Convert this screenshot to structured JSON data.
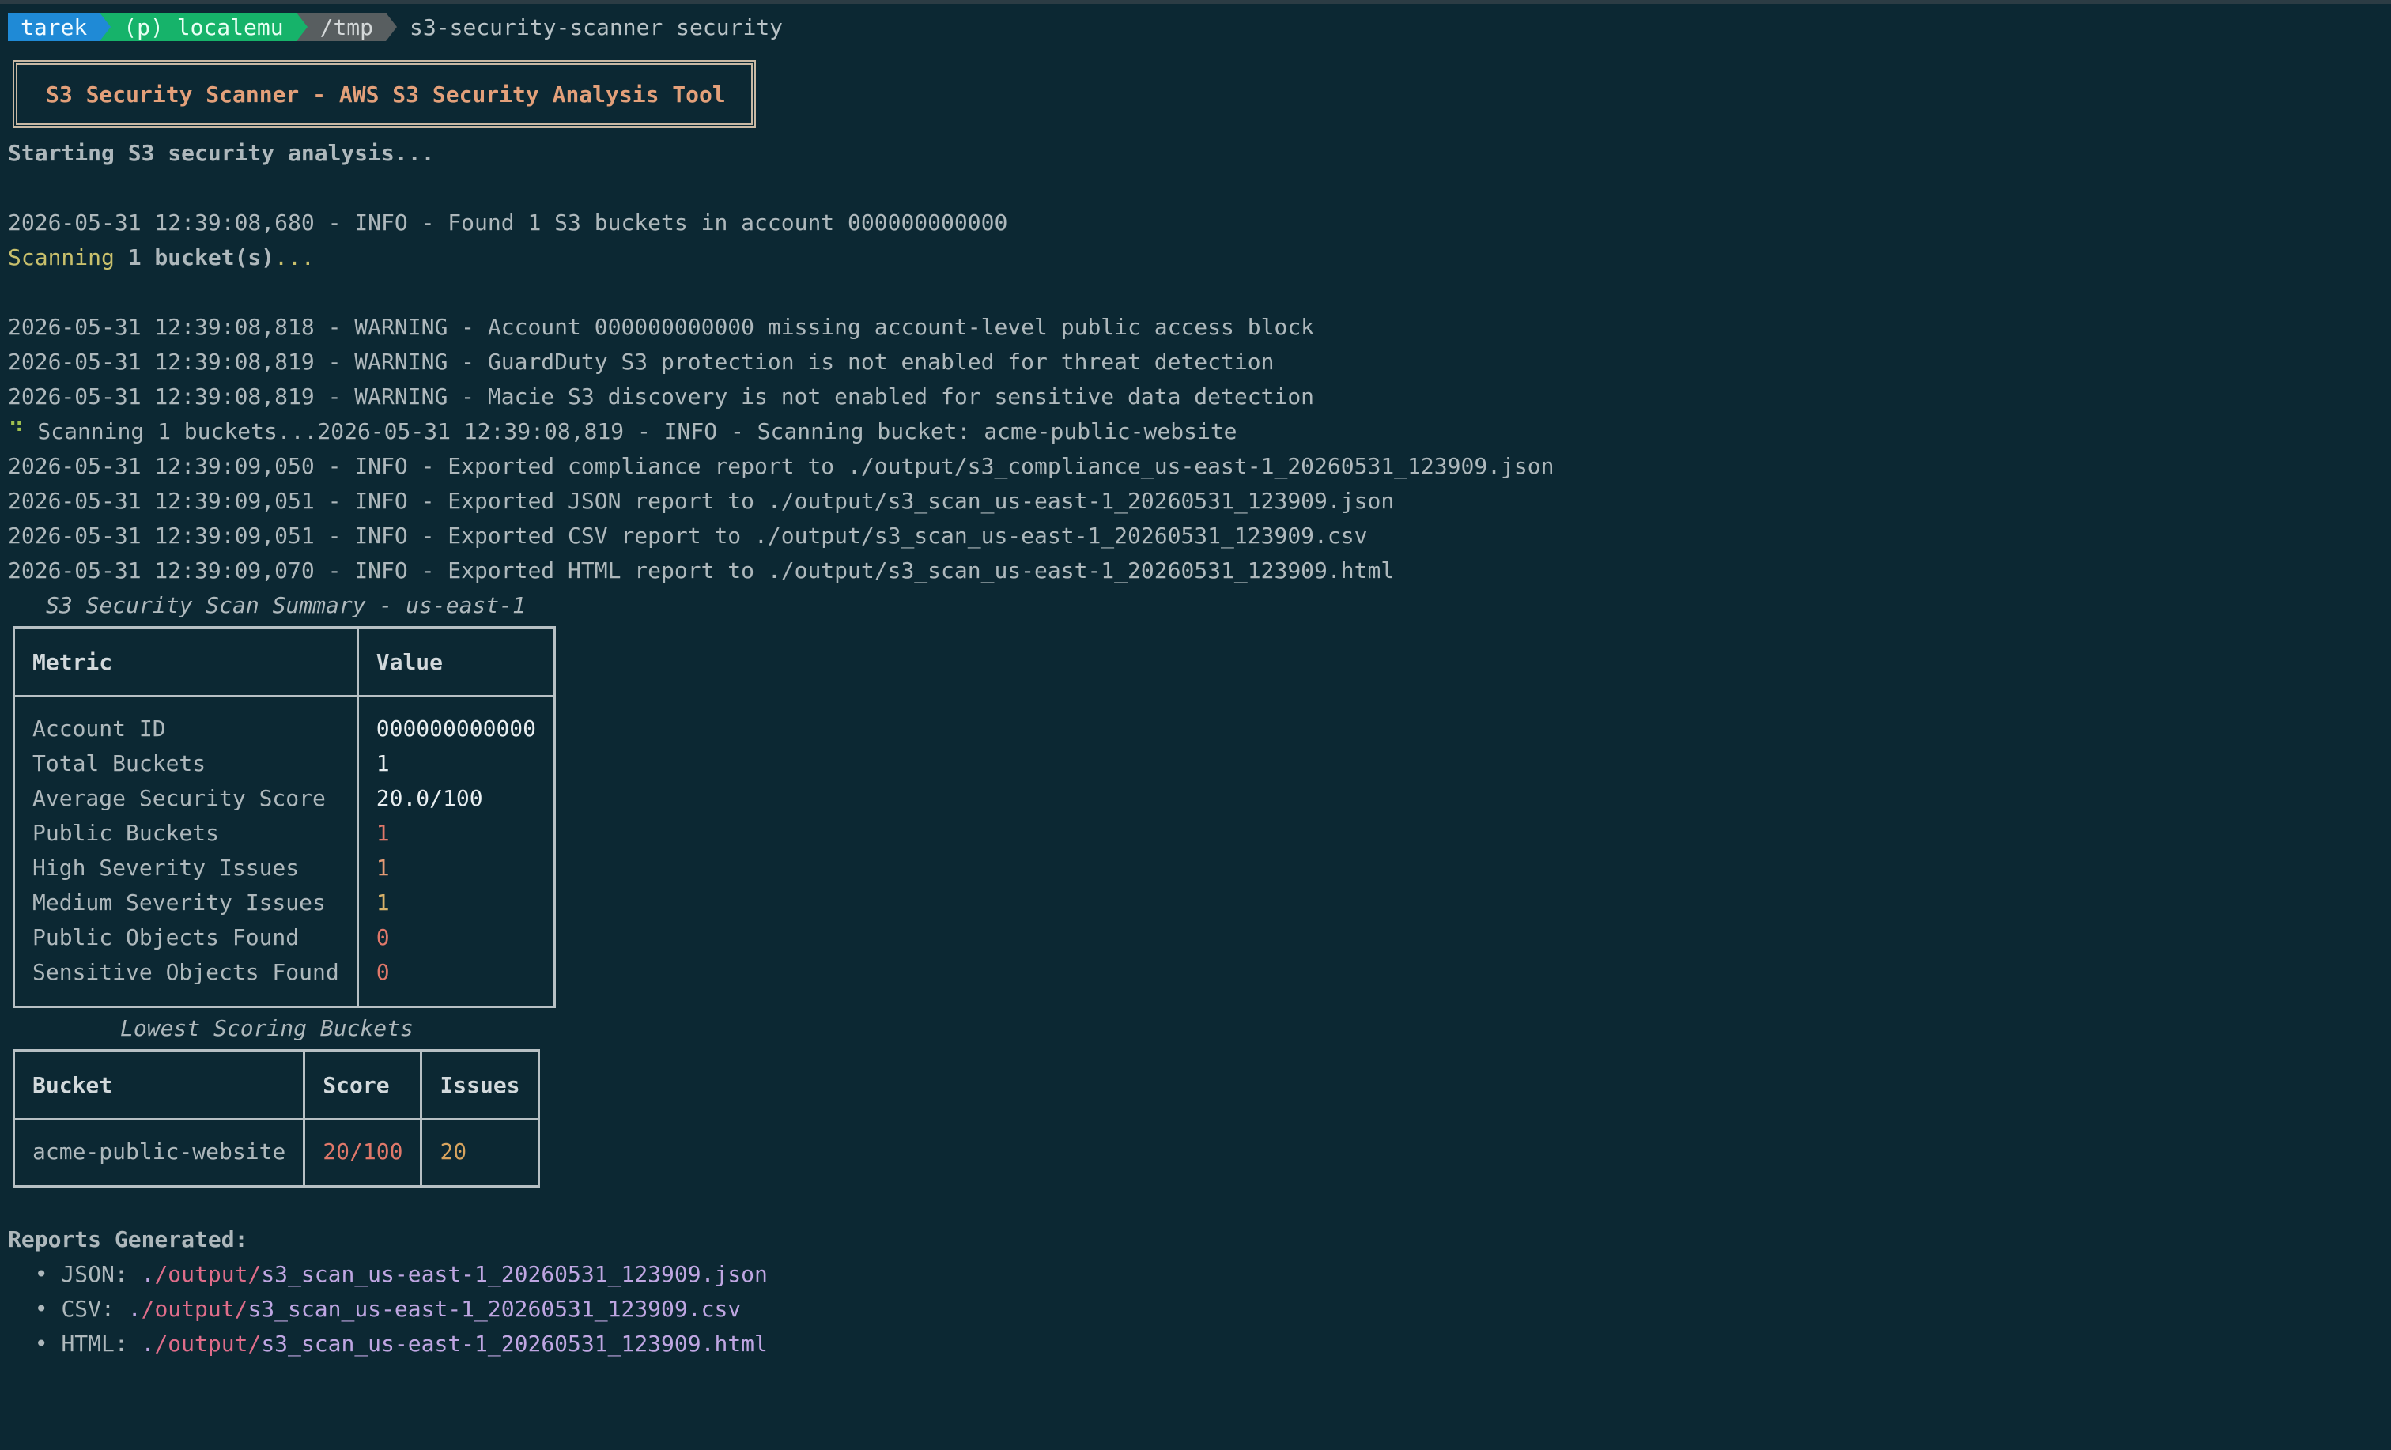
{
  "prompt": {
    "user": "tarek",
    "profile": "(p) localemu",
    "path": "/tmp",
    "command": "s3-security-scanner security"
  },
  "banner": "S3 Security Scanner - AWS S3 Security Analysis Tool",
  "starting": "Starting S3 security analysis...",
  "found_line": "2026-05-31 12:39:08,680 - INFO - Found 1 S3 buckets in account 000000000000",
  "scanning": {
    "word": "Scanning",
    "count": "1 bucket",
    "paren": "(s)",
    "dots": "..."
  },
  "log_lines": [
    "2026-05-31 12:39:08,818 - WARNING - Account 000000000000 missing account-level public access block",
    "2026-05-31 12:39:08,819 - WARNING - GuardDuty S3 protection is not enabled for threat detection",
    "2026-05-31 12:39:08,819 - WARNING - Macie S3 discovery is not enabled for sensitive data detection"
  ],
  "spinner_line": {
    "spinner": "⠙",
    "text": " Scanning 1 buckets...2026-05-31 12:39:08,819 - INFO - Scanning bucket: acme-public-website"
  },
  "export_lines": [
    "2026-05-31 12:39:09,050 - INFO - Exported compliance report to ./output/s3_compliance_us-east-1_20260531_123909.json",
    "2026-05-31 12:39:09,051 - INFO - Exported JSON report to ./output/s3_scan_us-east-1_20260531_123909.json",
    "2026-05-31 12:39:09,051 - INFO - Exported CSV report to ./output/s3_scan_us-east-1_20260531_123909.csv",
    "2026-05-31 12:39:09,070 - INFO - Exported HTML report to ./output/s3_scan_us-east-1_20260531_123909.html"
  ],
  "summary": {
    "caption": "S3 Security Scan Summary - us-east-1",
    "headers": [
      "Metric",
      "Value"
    ],
    "rows": [
      {
        "metric": "Account ID",
        "value": "000000000000",
        "color": "#e8eef0"
      },
      {
        "metric": "Total Buckets",
        "value": "1",
        "color": "#e8eef0"
      },
      {
        "metric": "Average Security Score",
        "value": "20.0/100",
        "color": "#e8eef0"
      },
      {
        "metric": "Public Buckets",
        "value": "1",
        "color": "#e0786a"
      },
      {
        "metric": "High Severity Issues",
        "value": "1",
        "color": "#e39b75"
      },
      {
        "metric": "Medium Severity Issues",
        "value": "1",
        "color": "#d8b26a"
      },
      {
        "metric": "Public Objects Found",
        "value": "0",
        "color": "#e0786a"
      },
      {
        "metric": "Sensitive Objects Found",
        "value": "0",
        "color": "#e0786a"
      }
    ]
  },
  "lowest": {
    "caption": "Lowest Scoring Buckets",
    "headers": [
      "Bucket",
      "Score",
      "Issues"
    ],
    "rows": [
      {
        "bucket": "acme-public-website",
        "score": "20/100",
        "issues": "20"
      }
    ]
  },
  "reports": {
    "title": "Reports Generated:",
    "items": [
      {
        "label": "JSON:",
        "dot": ".",
        "path": "/output/s3_scan_us-east-1_20260531_123909.json"
      },
      {
        "label": "CSV:",
        "dot": ".",
        "path": "/output/s3_scan_us-east-1_20260531_123909.csv"
      },
      {
        "label": "HTML:",
        "dot": ".",
        "path": "/output/s3_scan_us-east-1_20260531_123909.html"
      }
    ],
    "bullet": "•"
  }
}
